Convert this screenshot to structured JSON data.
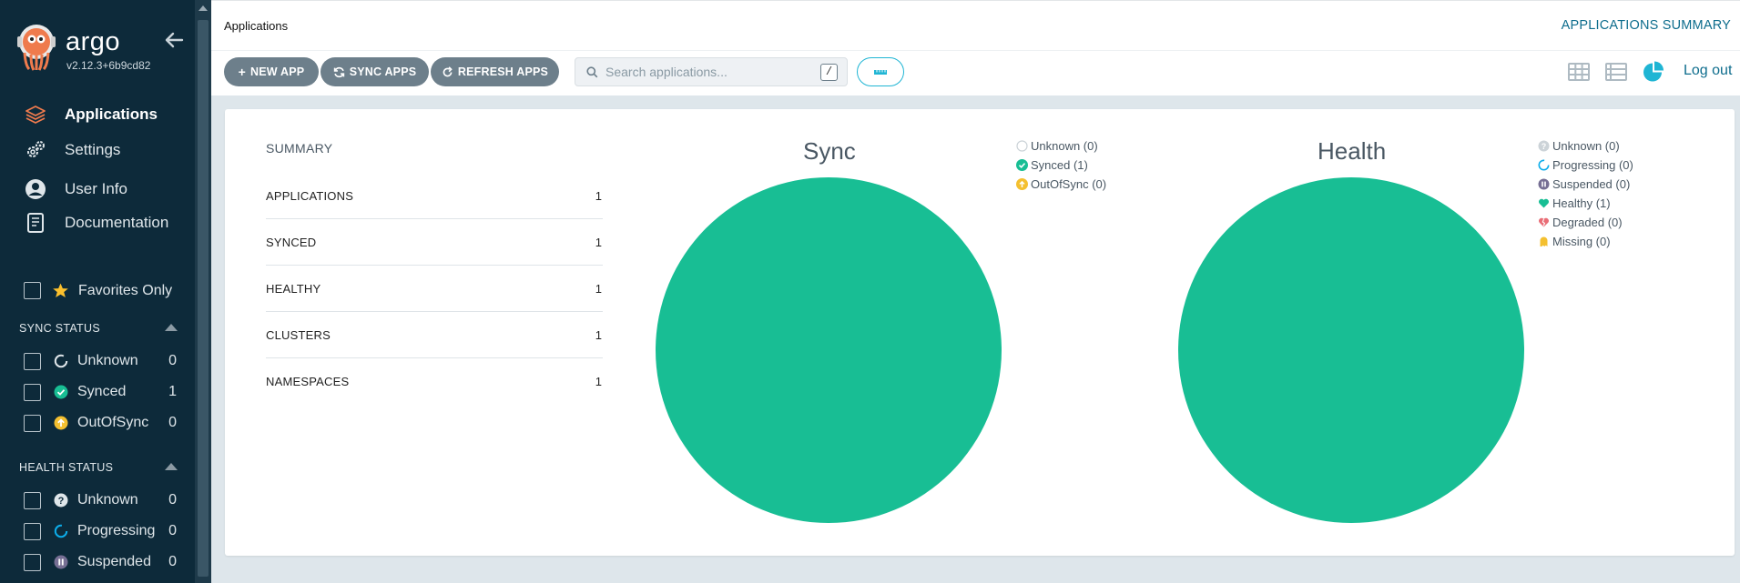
{
  "sidebar": {
    "brand": "argo",
    "version": "v2.12.3+6b9cd82",
    "nav": [
      {
        "label": "Applications",
        "icon": "layers-icon",
        "active": true
      },
      {
        "label": "Settings",
        "icon": "gears-icon"
      },
      {
        "label": "User Info",
        "icon": "user-circle-icon"
      },
      {
        "label": "Documentation",
        "icon": "book-icon"
      }
    ],
    "favorites_label": "Favorites Only",
    "sync_status": {
      "title": "SYNC STATUS",
      "items": [
        {
          "name": "Unknown",
          "count": "0",
          "icon": "circle-notch-icon"
        },
        {
          "name": "Synced",
          "count": "1",
          "icon": "check-circle-icon"
        },
        {
          "name": "OutOfSync",
          "count": "0",
          "icon": "arrow-up-circle-icon"
        }
      ]
    },
    "health_status": {
      "title": "HEALTH STATUS",
      "items": [
        {
          "name": "Unknown",
          "count": "0",
          "icon": "question-circle-icon"
        },
        {
          "name": "Progressing",
          "count": "0",
          "icon": "progress-ring-icon"
        },
        {
          "name": "Suspended",
          "count": "0",
          "icon": "pause-circle-icon"
        }
      ]
    }
  },
  "header": {
    "breadcrumb": "Applications",
    "title": "APPLICATIONS SUMMARY"
  },
  "toolbar": {
    "new_app": "NEW APP",
    "sync_apps": "SYNC APPS",
    "refresh_apps": "REFRESH APPS",
    "search_placeholder": "Search applications...",
    "search_shortcut": "/",
    "logout": "Log out",
    "views": [
      "tiles-view-icon",
      "list-view-icon",
      "pie-chart-view-icon"
    ]
  },
  "summary": {
    "title": "SUMMARY",
    "rows": [
      {
        "label": "APPLICATIONS",
        "value": "1"
      },
      {
        "label": "SYNCED",
        "value": "1"
      },
      {
        "label": "HEALTHY",
        "value": "1"
      },
      {
        "label": "CLUSTERS",
        "value": "1"
      },
      {
        "label": "NAMESPACES",
        "value": "1"
      }
    ]
  },
  "chart_data": [
    {
      "type": "pie",
      "title": "Sync",
      "categories": [
        "Unknown",
        "Synced",
        "OutOfSync"
      ],
      "values": [
        0,
        1,
        0
      ],
      "legend": [
        "Unknown (0)",
        "Synced (1)",
        "OutOfSync (0)"
      ],
      "colors": [
        "#cccccc",
        "#18be94",
        "#f4c030"
      ],
      "legend_position": "top-right"
    },
    {
      "type": "pie",
      "title": "Health",
      "categories": [
        "Unknown",
        "Progressing",
        "Suspended",
        "Healthy",
        "Degraded",
        "Missing"
      ],
      "values": [
        0,
        0,
        0,
        1,
        0,
        0
      ],
      "legend": [
        "Unknown (0)",
        "Progressing (0)",
        "Suspended (0)",
        "Healthy (1)",
        "Degraded (0)",
        "Missing (0)"
      ],
      "colors": [
        "#cccccc",
        "#0dadea",
        "#766f94",
        "#18be94",
        "#e96d76",
        "#f4c030"
      ],
      "legend_position": "top-right"
    }
  ],
  "colors": {
    "sidebar_bg": "#0d2a3a",
    "accent": "#0e6d8d",
    "button_bg": "#6d7f8b",
    "pie_green": "#18be94",
    "filter_border": "#1fb5d4"
  }
}
